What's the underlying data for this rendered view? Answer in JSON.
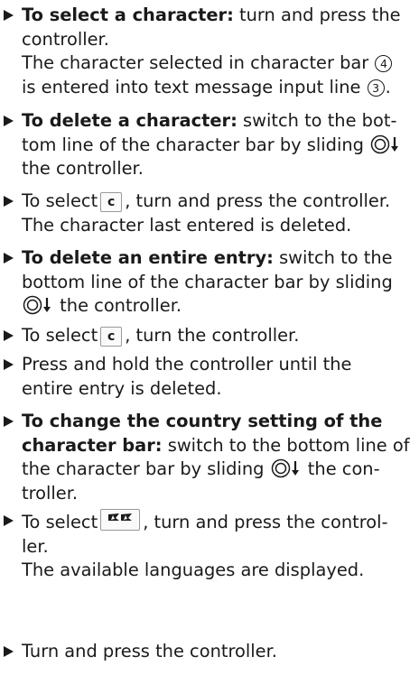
{
  "steps": [
    {
      "bold": "To select a character:",
      "l1": "turn and press the",
      "l2": "controller.",
      "l3a": "The character selected in character bar",
      "n4": "4",
      "l4a": "is entered into text message input line",
      "n3": "3",
      "l4b": "."
    },
    {
      "bold": "To delete a character:",
      "l1": "switch to the bot-",
      "l2": "tom line of the character bar by sliding",
      "l3": "the controller."
    },
    {
      "l1a": "To select",
      "key": "c",
      "l1b": ", turn and press the controller.",
      "l2": "The character last entered is deleted."
    },
    {
      "bold": "To delete an entire entry:",
      "l1": "switch to the",
      "l2": "bottom line of the character bar by sliding",
      "l3": "the controller."
    },
    {
      "l1a": "To select",
      "key": "c",
      "l1b": ", turn the controller."
    },
    {
      "l1": "Press and hold the controller until the",
      "l2": "entire entry is deleted."
    },
    {
      "bold1": "To change the country setting of the",
      "bold2": "character bar:",
      "l2": "switch to the bottom line of",
      "l3a": "the character bar by sliding",
      "l3b": "the con-",
      "l4": "troller."
    },
    {
      "l1a": "To select",
      "l1b": ", turn and press the control-",
      "l2": "ler.",
      "l3": "The available languages are displayed."
    },
    {
      "l1": "Turn and press the controller."
    }
  ]
}
